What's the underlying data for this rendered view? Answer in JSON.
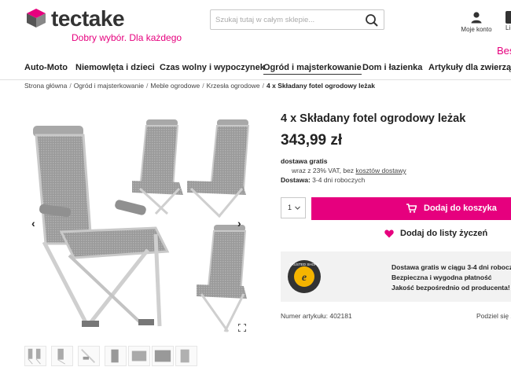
{
  "header": {
    "brand": "tectake",
    "tagline": "Dobry wybór. Dla każdego",
    "search_placeholder": "Szukaj tutaj w całym sklepie...",
    "account_label": "Moje konto",
    "cart_label_partial": "Li",
    "promo_partial": "Bes"
  },
  "nav": {
    "items": [
      {
        "label": "Auto-Moto"
      },
      {
        "label": "Niemowlęta i dzieci"
      },
      {
        "label": "Czas wolny i wypoczynek"
      },
      {
        "label": "Ogród i majsterkowanie",
        "active": true
      },
      {
        "label": "Dom i łazienka"
      },
      {
        "label": "Artykuły dla zwierząt"
      }
    ]
  },
  "breadcrumb": {
    "items": [
      "Strona główna",
      "Ogród i majsterkowanie",
      "Meble ogrodowe",
      "Krzesła ogrodowe"
    ],
    "current": "4 x Składany fotel ogrodowy leżak"
  },
  "product": {
    "title": "4 x Składany fotel ogrodowy leżak",
    "price": "343,99 zł",
    "shipping_free": "dostawa gratis",
    "vat_text": "wraz z 23% VAT, bez ",
    "shipping_cost_link": "kosztów dostawy",
    "delivery_label": "Dostawa:",
    "delivery_value": " 3-4 dni roboczych",
    "quantity": "1",
    "add_to_cart_label": "Dodaj do koszyka",
    "wishlist_label": "Dodaj do listy życzeń",
    "trust_lines": [
      "Dostawa gratis w ciągu 3-4 dni roboczy",
      "Bezpieczna i wygodna płatność",
      "Jakość bezpośrednio od producenta!"
    ],
    "trust_badge_text": "TRUSTED SHOPS",
    "article_number": "Numer artykułu: 402181",
    "share_label": "Podziel się z"
  },
  "gallery": {
    "prev_glyph": "‹",
    "next_glyph": "›",
    "thumbnail_count": 7
  },
  "colors": {
    "accent": "#e6007e",
    "text": "#222222",
    "trust_bg": "#f2f2f2"
  }
}
